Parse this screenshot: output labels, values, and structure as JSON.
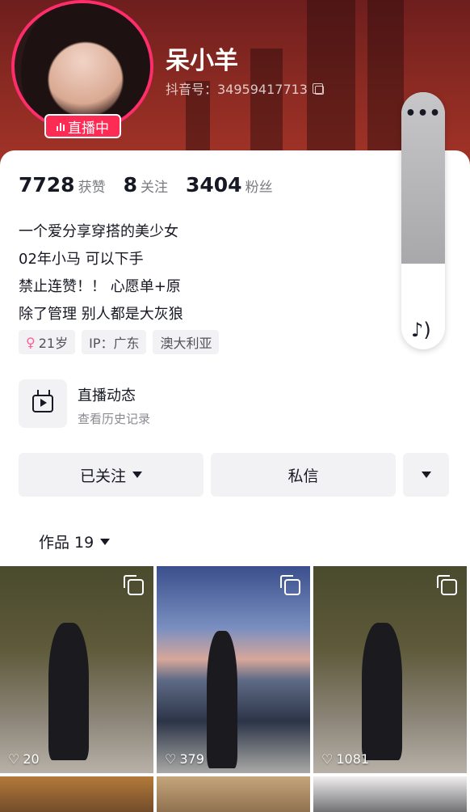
{
  "profile": {
    "nickname": "呆小羊",
    "account_id": "抖音号：34959417713",
    "live_badge": "直播中"
  },
  "stats": {
    "likes_count": "7728",
    "likes_label": "获赞",
    "following_count": "8",
    "following_label": "关注",
    "followers_count": "3404",
    "followers_label": "粉丝"
  },
  "bio": {
    "lines": [
      "一个爱分享穿搭的美少女",
      "02年小马 可以下手",
      "禁止连赞！！ 心愿单+原",
      "除了管理 别人都是大灰狼"
    ]
  },
  "tags": {
    "age": "21岁",
    "ip": "IP：广东",
    "location": "澳大利亚"
  },
  "live_history": {
    "title": "直播动态",
    "subtitle": "查看历史记录"
  },
  "actions": {
    "followed_label": "已关注",
    "message_label": "私信"
  },
  "works_tab": {
    "label": "作品 19"
  },
  "grid": {
    "items": [
      {
        "likes": "20",
        "icon": "multi-image-icon"
      },
      {
        "likes": "379",
        "icon": "multi-image-icon"
      },
      {
        "likes": "1081",
        "icon": "multi-image-icon"
      }
    ]
  },
  "colors": {
    "accent": "#fe2c55",
    "header": "#8a2a22"
  }
}
